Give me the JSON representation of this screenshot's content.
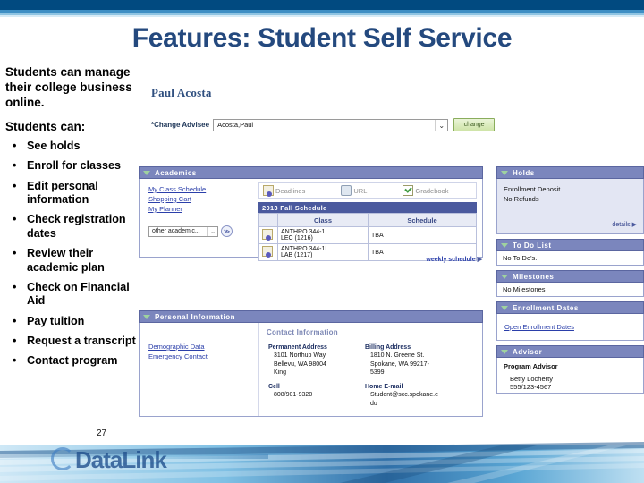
{
  "slide": {
    "title": "Features: Student Self Service",
    "page_number": "27",
    "logo_text": "DataLink",
    "accent_navy": "#014a80",
    "title_color": "#24497e"
  },
  "left_column": {
    "lead_paragraph": "Students can manage their college business online.",
    "lead_subhead": "Students can:",
    "bullet_marker": "•",
    "bullets": [
      "See holds",
      "Enroll for classes",
      "Edit personal information",
      "Check registration dates",
      "Review their academic plan",
      "Check on Financial Aid",
      "Pay tuition",
      "Request a transcript",
      "Contact program"
    ]
  },
  "screenshot": {
    "student_name": "Paul Acosta",
    "change_advisee": {
      "label": "*Change Advisee",
      "selected": "Acosta,Paul",
      "button_label": "change",
      "caret": "⌄"
    },
    "academics": {
      "panel_title": "Academics",
      "links": [
        "My Class Schedule",
        "Shopping Cart",
        "My Planner"
      ],
      "other_select": {
        "selected": "other academic...",
        "caret": "⌄",
        "go_label": "≫"
      },
      "icon_bar": [
        {
          "label": "Deadlines",
          "icon": "deadlines-icon"
        },
        {
          "label": "URL",
          "icon": "url-icon"
        },
        {
          "label": "Gradebook",
          "icon": "gradebook-icon"
        }
      ],
      "schedule": {
        "title": "2013 Fall Schedule",
        "columns": [
          "",
          "Class",
          "Schedule"
        ],
        "rows": [
          {
            "class_line1": "ANTHRO 344-1",
            "class_line2": "LEC (1216)",
            "schedule": "TBA"
          },
          {
            "class_line1": "ANTHRO 344-1L",
            "class_line2": "LAB (1217)",
            "schedule": "TBA"
          }
        ],
        "weekly_link": "weekly schedule",
        "weekly_arrow": "▶"
      }
    },
    "personal_information": {
      "panel_title": "Personal Information",
      "links": [
        "Demographic Data",
        "Emergency Contact"
      ],
      "contact_information": {
        "title": "Contact Information",
        "permanent_address": {
          "heading": "Permanent Address",
          "line1": "3101 Northup Way",
          "line2": "Bellevu, WA 98004",
          "line3": "King"
        },
        "billing_address": {
          "heading": "Billing Address",
          "line1": "1810 N. Greene St.",
          "line2": "Spokane, WA 99217-",
          "line3": "5399"
        },
        "cell": {
          "heading": "Cell",
          "value": "808/901-9320"
        },
        "home_email": {
          "heading": "Home E-mail",
          "line1": "Student@scc.spokane.e",
          "line2": "du"
        }
      }
    },
    "right_rail": {
      "holds": {
        "panel_title": "Holds",
        "items": [
          "Enrollment Deposit",
          "No Refunds"
        ],
        "details_link": "details",
        "details_arrow": "▶"
      },
      "todo": {
        "panel_title": "To Do List",
        "empty_text": "No To Do's."
      },
      "milestones": {
        "panel_title": "Milestones",
        "empty_text": "No Milestones"
      },
      "enrollment_dates": {
        "panel_title": "Enrollment Dates",
        "link": "Open Enrollment Dates"
      },
      "advisor": {
        "panel_title": "Advisor",
        "heading": "Program Advisor",
        "name": "Betty Locherty",
        "phone": "555/123-4567"
      }
    }
  }
}
